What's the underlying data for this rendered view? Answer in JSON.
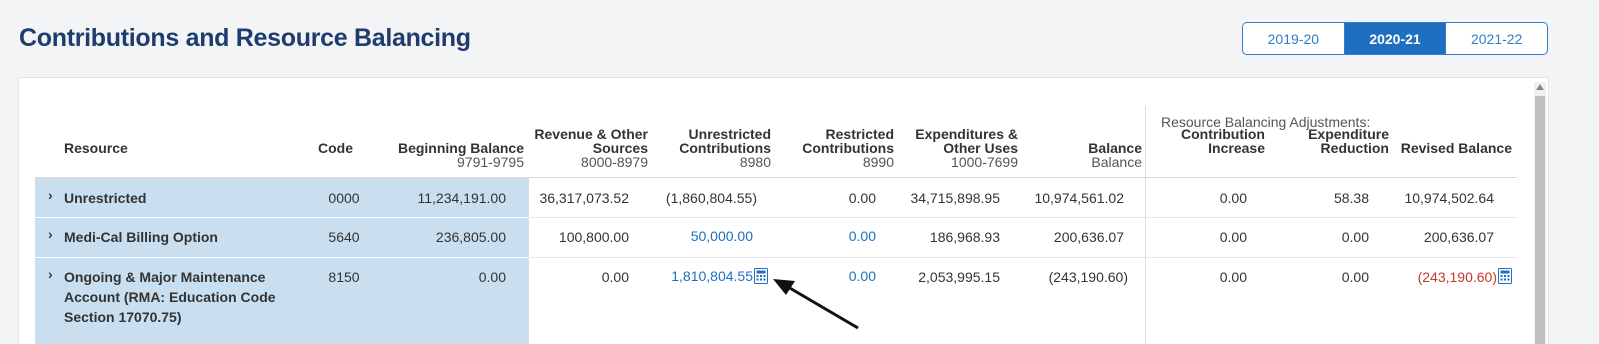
{
  "page": {
    "title": "Contributions and Resource Balancing"
  },
  "year_tabs": [
    {
      "label": "2019-20",
      "active": false
    },
    {
      "label": "2020-21",
      "active": true
    },
    {
      "label": "2021-22",
      "active": false
    }
  ],
  "table": {
    "group_title": "Resource Balancing Adjustments:",
    "headers": {
      "resource": "Resource",
      "code": "Code",
      "beginning": {
        "label": "Beginning Balance",
        "sub": "9791-9795"
      },
      "revenue": {
        "label1": "Revenue & Other",
        "label2": "Sources",
        "sub": "8000-8979"
      },
      "unrestricted": {
        "label1": "Unrestricted",
        "label2": "Contributions",
        "sub": "8980"
      },
      "restricted": {
        "label1": "Restricted",
        "label2": "Contributions",
        "sub": "8990"
      },
      "expenditures": {
        "label1": "Expenditures &",
        "label2": "Other Uses",
        "sub": "1000-7699"
      },
      "balance": {
        "label": "Balance",
        "sub": "Balance"
      },
      "contrib_increase": {
        "label1": "Contribution",
        "label2": "Increase"
      },
      "expend_reduction": {
        "label1": "Expenditure",
        "label2": "Reduction"
      },
      "revised": "Revised Balance"
    },
    "rows": [
      {
        "name": "Unrestricted",
        "code": "0000",
        "beginning": "11,234,191.00",
        "revenue": "36,317,073.52",
        "unrestricted": "(1,860,804.55)",
        "restricted": "0.00",
        "expenditures": "34,715,898.95",
        "balance": "10,974,561.02",
        "contrib_increase": "0.00",
        "expend_reduction": "58.38",
        "revised": "10,974,502.64"
      },
      {
        "name": "Medi-Cal Billing Option",
        "code": "5640",
        "beginning": "236,805.00",
        "revenue": "100,800.00",
        "unrestricted": "50,000.00",
        "restricted": "0.00",
        "expenditures": "186,968.93",
        "balance": "200,636.07",
        "contrib_increase": "0.00",
        "expend_reduction": "0.00",
        "revised": "200,636.07"
      },
      {
        "name_line1": "Ongoing & Major Maintenance",
        "name_line2": "Account (RMA: Education Code",
        "name_line3": "Section 17070.75)",
        "code": "8150",
        "beginning": "0.00",
        "revenue": "0.00",
        "unrestricted": "1,810,804.55",
        "restricted": "0.00",
        "expenditures": "2,053,995.15",
        "balance": "(243,190.60)",
        "contrib_increase": "0.00",
        "expend_reduction": "0.00",
        "revised": "(243,190.60)"
      }
    ]
  },
  "icons": {
    "expand": "chevron-right-icon",
    "calculator": "calculator-icon",
    "pointer_arrow": "arrow-pointer-icon"
  },
  "colors": {
    "title": "#1f3c6e",
    "accent": "#1f6fc0",
    "resource_bg": "#c9dff0",
    "negative": "#c0392b"
  }
}
